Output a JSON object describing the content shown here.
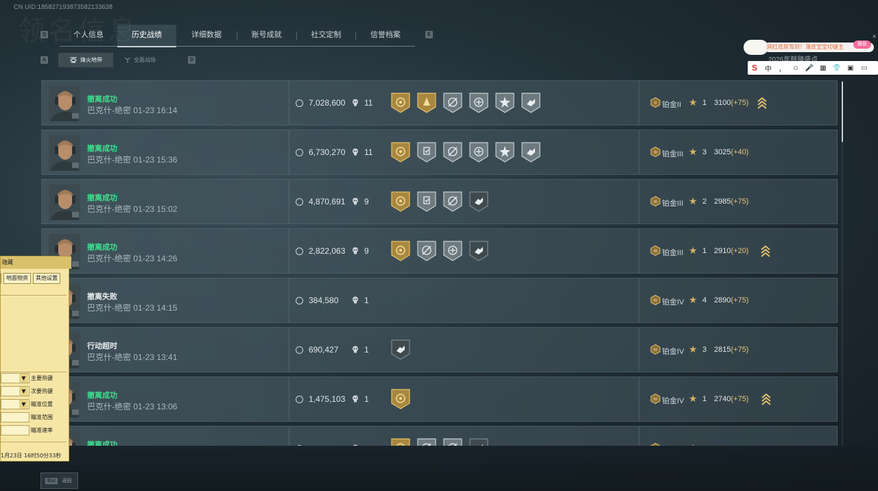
{
  "uid_text": "CN UID:1858271938735821336​38",
  "bg_title": "领名信息",
  "key_q": "Q",
  "key_e": "E",
  "key_a": "A",
  "key_d": "D",
  "tabs": [
    {
      "label": "个人信息"
    },
    {
      "label": "历史战绩"
    },
    {
      "label": "详细数据"
    },
    {
      "label": "账号成就"
    },
    {
      "label": "社交定制"
    },
    {
      "label": "信誉档案"
    }
  ],
  "subtabs": [
    {
      "label": "烽火地带",
      "icon": "helicopter-icon"
    },
    {
      "label": "全面战场",
      "icon": "battlefield-icon"
    }
  ],
  "ime": {
    "banner": "网红皮肤驾到！薄皮宝宝切键主",
    "skin_button": "换肤",
    "close": "×",
    "sub_text": "2026年鼓踊盛点",
    "bar_items": [
      "S",
      "中",
      "，",
      "☺",
      "🎤",
      "▦",
      "👕",
      "▣",
      "▭"
    ]
  },
  "matches": [
    {
      "status": "撤离成功",
      "status_type": "ok",
      "map": "巴克什-绝密",
      "time": "01-23 16:14",
      "value": "7,028,600",
      "kills": "11",
      "medals": [
        "gold-sniper",
        "gold-spartan",
        "silver-crosshair",
        "silver-shield",
        "silver-burst",
        "silver-hand"
      ],
      "rank": "铂金II",
      "rank_icon": "II",
      "stars": "1",
      "points": "3100",
      "delta": "(+75)",
      "chevron": true
    },
    {
      "status": "撤离成功",
      "status_type": "ok",
      "map": "巴克什-绝密",
      "time": "01-23 15:36",
      "value": "6,730,270",
      "kills": "11",
      "medals": [
        "gold-sniper",
        "silver-checklist",
        "silver-crosshair",
        "silver-shield",
        "silver-burst",
        "silver-hand"
      ],
      "rank": "铂金III",
      "rank_icon": "III",
      "stars": "3",
      "points": "3025",
      "delta": "(+40)",
      "chevron": false
    },
    {
      "status": "撤离成功",
      "status_type": "ok",
      "map": "巴克什-绝密",
      "time": "01-23 15:02",
      "value": "4,870,691",
      "kills": "9",
      "medals": [
        "gold-sniper",
        "silver-checklist",
        "silver-crosshair",
        "dark-hand"
      ],
      "rank": "铂金III",
      "rank_icon": "III",
      "stars": "2",
      "points": "2985",
      "delta": "(+75)",
      "chevron": false
    },
    {
      "status": "撤离成功",
      "status_type": "ok",
      "map": "巴克什-绝密",
      "time": "01-23 14:26",
      "value": "2,822,063",
      "kills": "9",
      "medals": [
        "gold-sniper",
        "silver-crosshair",
        "silver-shield",
        "dark-hand"
      ],
      "rank": "铂金III",
      "rank_icon": "III",
      "stars": "1",
      "points": "2910",
      "delta": "(+20)",
      "chevron": true
    },
    {
      "status": "撤离失败",
      "status_type": "fail",
      "map": "巴克什-绝密",
      "time": "01-23 14:15",
      "value": "384,580",
      "kills": "1",
      "medals": [],
      "rank": "铂金IV",
      "rank_icon": "IV",
      "stars": "4",
      "points": "2890",
      "delta": "(+75)",
      "chevron": false
    },
    {
      "status": "行动超时",
      "status_type": "fail",
      "map": "巴克什-绝密",
      "time": "01-23 13:41",
      "value": "690,427",
      "kills": "1",
      "medals": [
        "dark-hand"
      ],
      "rank": "铂金IV",
      "rank_icon": "IV",
      "stars": "3",
      "points": "2815",
      "delta": "(+75)",
      "chevron": false
    },
    {
      "status": "撤离成功",
      "status_type": "ok",
      "map": "巴克什-绝密",
      "time": "01-23 13:06",
      "value": "1,475,103",
      "kills": "1",
      "medals": [
        "gold-sniper"
      ],
      "rank": "铂金IV",
      "rank_icon": "IV",
      "stars": "1",
      "points": "2740",
      "delta": "(+75)",
      "chevron": true
    },
    {
      "status": "撤离成功",
      "status_type": "ok",
      "map": "巴克什-绝密",
      "time": "",
      "value": "",
      "kills": "",
      "medals": [
        "gold-sniper",
        "silver-crosshair",
        "silver-crosshair",
        "dark-hand"
      ],
      "rank": "",
      "rank_icon": "IV",
      "stars": "",
      "points": "",
      "delta": "",
      "chevron": false
    }
  ],
  "esc": {
    "key": "Esc",
    "label": "返回"
  },
  "panel": {
    "title": "隐藏",
    "buttons": [
      "",
      "地面物资",
      "其他设置"
    ],
    "fields": [
      "主要热键",
      "次要热键",
      "瞄准位置",
      "瞄准范围",
      "瞄准速率"
    ],
    "timestamp": "1月23日 16时50分33秒"
  },
  "colors": {
    "success": "#3ee08e",
    "gold": "#d3b165",
    "delta": "#e5c679"
  }
}
